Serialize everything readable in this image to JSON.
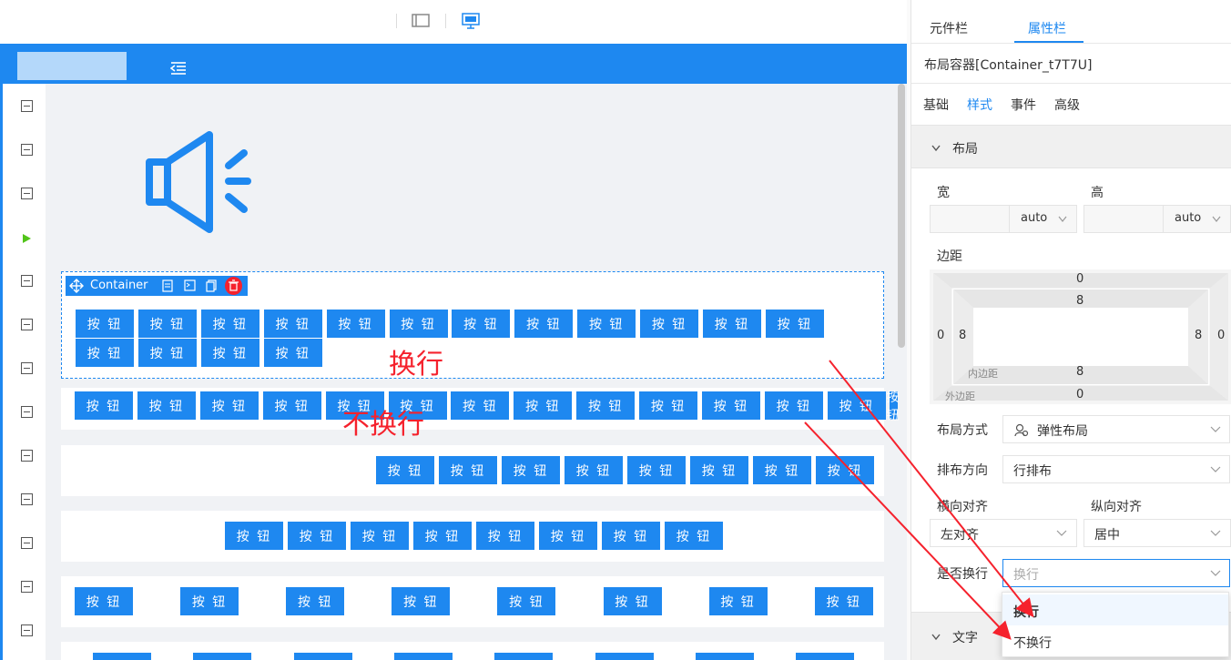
{
  "panel": {
    "tabs": [
      {
        "label": "元件栏"
      },
      {
        "label": "属性栏"
      }
    ],
    "component_name": "布局容器[Container_t7T7U]",
    "subtabs": [
      {
        "label": "基础"
      },
      {
        "label": "样式"
      },
      {
        "label": "事件"
      },
      {
        "label": "高级"
      }
    ],
    "layout_section": "布局",
    "width_label": "宽",
    "height_label": "高",
    "width_unit": "auto",
    "height_unit": "auto",
    "margin_label": "边距",
    "box_model": {
      "outer_top": "0",
      "outer_left": "0",
      "outer_right": "0",
      "outer_bottom": "0",
      "inner_top": "8",
      "inner_left": "8",
      "inner_right": "8",
      "inner_bottom": "8",
      "inner_label": "内边距",
      "outer_label": "外边距"
    },
    "layout_mode_label": "布局方式",
    "layout_mode_value": "弹性布局",
    "direction_label": "排布方向",
    "direction_value": "行排布",
    "h_align_label": "横向对齐",
    "h_align_value": "左对齐",
    "v_align_label": "纵向对齐",
    "v_align_value": "居中",
    "wrap_label": "是否换行",
    "wrap_value": "换行",
    "wrap_options": [
      {
        "label": "换行"
      },
      {
        "label": "不换行"
      }
    ],
    "text_section": "文字"
  },
  "canvas": {
    "container_tag": "Container",
    "button_label": "按 钮",
    "annotation_wrap": "换行",
    "annotation_nowrap": "不换行"
  },
  "colors": {
    "primary": "#1e88f0",
    "annotation": "#f5222d",
    "accent_play": "#52c41a"
  },
  "icons": {
    "toolbar": [
      "tablet-icon",
      "desktop-icon"
    ],
    "header": [
      "menu-fold-icon"
    ],
    "main": [
      "speaker-icon"
    ],
    "container_tools": [
      "move-icon",
      "document-icon",
      "code-icon",
      "copy-icon",
      "trash-icon"
    ]
  }
}
